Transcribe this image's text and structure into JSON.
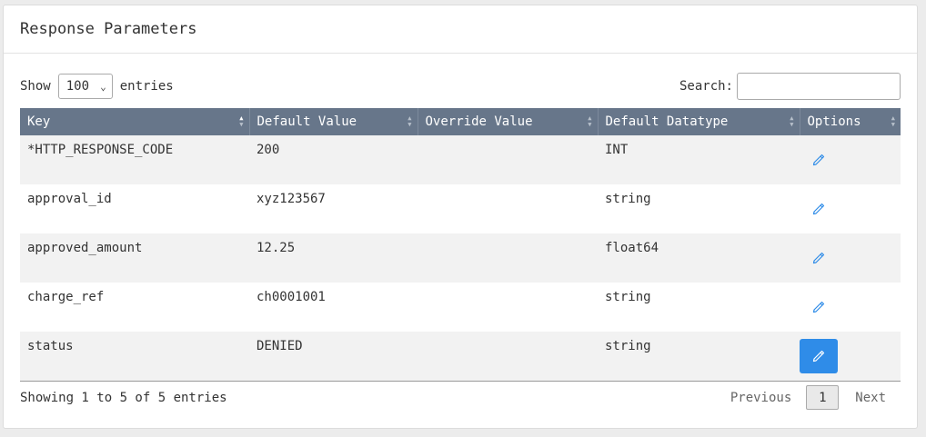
{
  "panel": {
    "title": "Response Parameters"
  },
  "length": {
    "show_label": "Show",
    "value": "100",
    "entries_label": "entries"
  },
  "search": {
    "label": "Search:",
    "value": ""
  },
  "table": {
    "headers": [
      "Key",
      "Default Value",
      "Override Value",
      "Default Datatype",
      "Options"
    ],
    "rows": [
      {
        "key": "*HTTP_RESPONSE_CODE",
        "default_value": "200",
        "override_value": "",
        "datatype": "INT"
      },
      {
        "key": "approval_id",
        "default_value": "xyz123567",
        "override_value": "",
        "datatype": "string"
      },
      {
        "key": "approved_amount",
        "default_value": "12.25",
        "override_value": "",
        "datatype": "float64"
      },
      {
        "key": "charge_ref",
        "default_value": "ch0001001",
        "override_value": "",
        "datatype": "string"
      },
      {
        "key": "status",
        "default_value": "DENIED",
        "override_value": "",
        "datatype": "string"
      }
    ],
    "option_icon": "pencil-icon",
    "accent": "#2f8ce8",
    "header_bg": "#67768a"
  },
  "footer": {
    "info": "Showing 1 to 5 of 5 entries",
    "previous": "Previous",
    "current_page": "1",
    "next": "Next"
  }
}
